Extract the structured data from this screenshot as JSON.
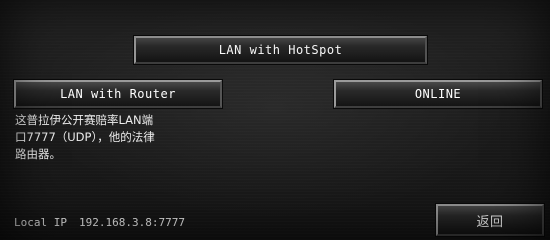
{
  "buttons": {
    "lan_hotspot": "LAN with HotSpot",
    "lan_router": "LAN with Router",
    "online": "ONLINE",
    "back": "返回"
  },
  "description": {
    "lines": [
      "这普拉伊公开赛赔率LAN端",
      "口7777（UDP），他的法律",
      "路由器。"
    ]
  },
  "network": {
    "local_ip_label": "Local IP",
    "local_ip_value": "192.168.3.8:7777"
  }
}
